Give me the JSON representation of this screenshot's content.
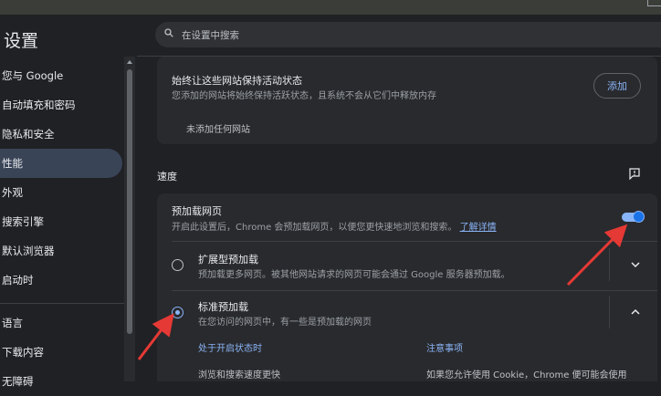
{
  "sidebar": {
    "title": "设置",
    "items": [
      {
        "label": "您与 Google"
      },
      {
        "label": "自动填充和密码"
      },
      {
        "label": "隐私和安全"
      },
      {
        "label": "性能"
      },
      {
        "label": "外观"
      },
      {
        "label": "搜索引擎"
      },
      {
        "label": "默认浏览器"
      },
      {
        "label": "启动时"
      },
      {
        "label": "语言"
      },
      {
        "label": "下载内容"
      },
      {
        "label": "无障碍"
      }
    ]
  },
  "search": {
    "placeholder": "在设置中搜索"
  },
  "active_sites": {
    "title": "始终让这些网站保持活动状态",
    "description": "您添加的网站将始终保持活跃状态，且系统不会从它们中释放内存",
    "add_label": "添加",
    "empty_text": "未添加任何网站"
  },
  "speed": {
    "section_label": "速度",
    "preload": {
      "title": "预加载网页",
      "description": "开启此设置后，Chrome 会预加载网页，以便您更快速地浏览和搜索。",
      "learn_more": "了解详情",
      "enabled": true
    },
    "options": [
      {
        "title": "扩展型预加载",
        "description": "预加载更多网页。被其他网站请求的网页可能会通过 Google 服务器预加载。",
        "selected": false
      },
      {
        "title": "标准预加载",
        "description": "在您访问的网页中，有一些是预加载的网页",
        "selected": true
      }
    ],
    "expanded": {
      "col1_header": "处于开启状态时",
      "col2_header": "注意事项",
      "col1_item": "浏览和搜索速度更快",
      "col2_item": "如果您允许使用 Cookie，Chrome 便可能会使用"
    }
  },
  "colors": {
    "accent": "#8ab4f8",
    "background": "#202124",
    "card": "#292a2d",
    "annotation_arrow": "#e53935"
  }
}
